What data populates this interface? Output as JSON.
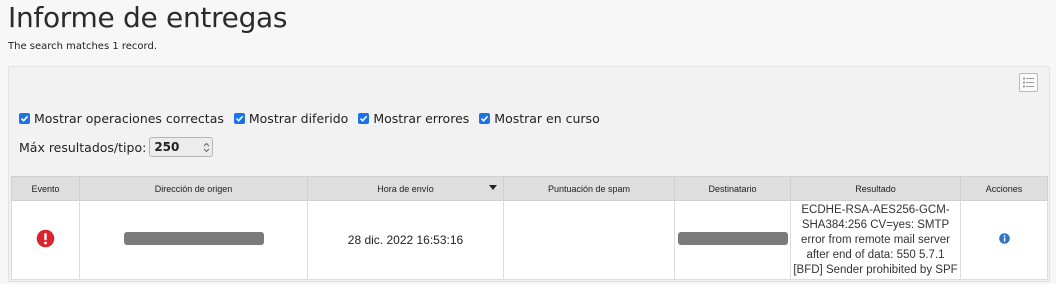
{
  "header": {
    "title": "Informe de entregas",
    "match_count": "The search matches 1 record."
  },
  "toolbar": {
    "list_view_icon": "list-view-icon"
  },
  "filters": {
    "show_ok": {
      "label": "Mostrar operaciones correctas",
      "checked": true
    },
    "show_deferred": {
      "label": "Mostrar diferido",
      "checked": true
    },
    "show_errors": {
      "label": "Mostrar errores",
      "checked": true
    },
    "show_in_progress": {
      "label": "Mostrar en curso",
      "checked": true
    }
  },
  "max_results": {
    "label": "Máx resultados/tipo:",
    "value": "250"
  },
  "table": {
    "columns": [
      "Evento",
      "Dirección de origen",
      "Hora de envío",
      "Puntuación de spam",
      "Destinatario",
      "Resultado",
      "Acciones"
    ],
    "sorted_column": "Hora de envío",
    "rows": [
      {
        "event_icon": "error-icon",
        "sender": "",
        "sent_time": "28 dic. 2022 16:53:16",
        "spam_score": "",
        "recipient": "",
        "result": "ECDHE-RSA-AES256-GCM-SHA384:256 CV=yes: SMTP error from remote mail server after end of data: 550 5.7.1 [BFD] Sender prohibited by SPF",
        "action_icon": "info-icon"
      }
    ]
  },
  "colors": {
    "checkbox": "#1a73e8",
    "error": "#d9262c",
    "info": "#2f74c0"
  }
}
